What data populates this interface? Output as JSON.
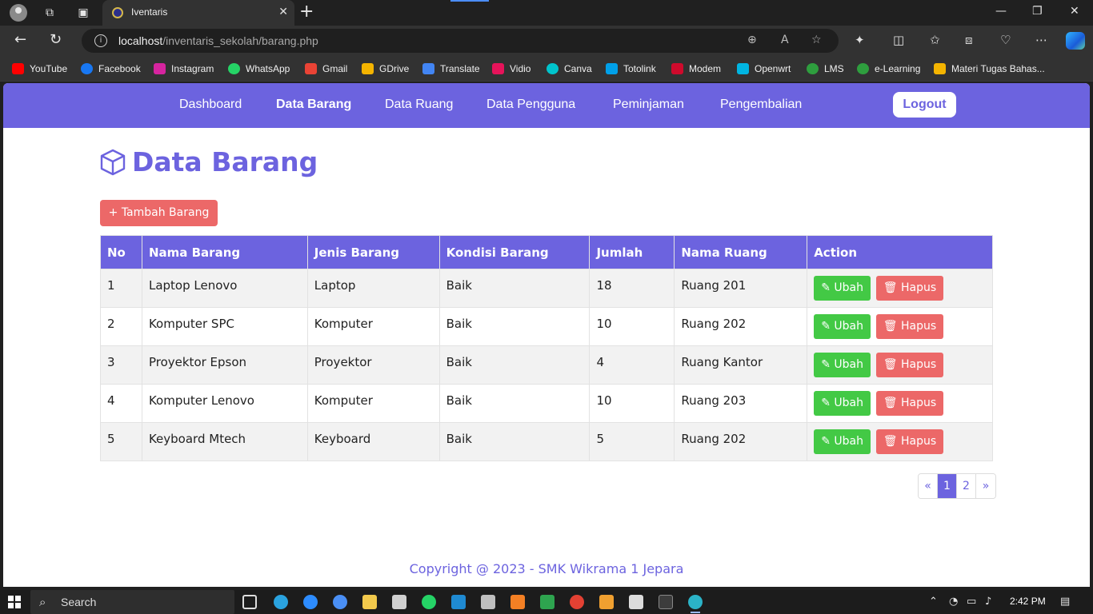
{
  "browser": {
    "tab_title": "Iventaris",
    "url_host": "localhost",
    "url_path": "/inventaris_sekolah/barang.php",
    "bookmarks": [
      {
        "label": "YouTube",
        "icon": "youtube-icon",
        "color": "#ff0000"
      },
      {
        "label": "Facebook",
        "icon": "facebook-icon",
        "color": "#1877f2"
      },
      {
        "label": "Instagram",
        "icon": "instagram-icon",
        "color": "#d6249f"
      },
      {
        "label": "WhatsApp",
        "icon": "whatsapp-icon",
        "color": "#25d366"
      },
      {
        "label": "Gmail",
        "icon": "gmail-icon",
        "color": "#ea4335"
      },
      {
        "label": "GDrive",
        "icon": "gdrive-icon",
        "color": "#f4b400"
      },
      {
        "label": "Translate",
        "icon": "translate-icon",
        "color": "#4285f4"
      },
      {
        "label": "Vidio",
        "icon": "vidio-icon",
        "color": "#e6135a"
      },
      {
        "label": "Canva",
        "icon": "canva-icon",
        "color": "#00c4cc"
      },
      {
        "label": "Totolink",
        "icon": "totolink-icon",
        "color": "#00a0e9"
      },
      {
        "label": "Modem",
        "icon": "modem-icon",
        "color": "#cf0a2c"
      },
      {
        "label": "Openwrt",
        "icon": "openwrt-icon",
        "color": "#00b5e2"
      },
      {
        "label": "LMS",
        "icon": "lms-icon",
        "color": "#2e9e3e"
      },
      {
        "label": "e-Learning",
        "icon": "elearning-icon",
        "color": "#2e9e3e"
      },
      {
        "label": "Materi Tugas Bahas...",
        "icon": "gdrive-icon",
        "color": "#f4b400"
      }
    ]
  },
  "nav": {
    "links": [
      "Dashboard",
      "Data Barang",
      "Data Ruang",
      "Data Pengguna",
      "Peminjaman",
      "Pengembalian"
    ],
    "active": "Data Barang",
    "logout_label": "Logout"
  },
  "colors": {
    "accent": "#6c63df",
    "success": "#43c945",
    "danger": "#ec6868"
  },
  "main": {
    "title": "Data Barang",
    "add_button_label": "+ Tambah Barang",
    "table": {
      "headers": [
        "No",
        "Nama Barang",
        "Jenis Barang",
        "Kondisi Barang",
        "Jumlah",
        "Nama Ruang",
        "Action"
      ],
      "rows": [
        [
          "1",
          "Laptop Lenovo",
          "Laptop",
          "Baik",
          "18",
          "Ruang 201"
        ],
        [
          "2",
          "Komputer SPC",
          "Komputer",
          "Baik",
          "10",
          "Ruang 202"
        ],
        [
          "3",
          "Proyektor Epson",
          "Proyektor",
          "Baik",
          "4",
          "Ruang Kantor"
        ],
        [
          "4",
          "Komputer Lenovo",
          "Komputer",
          "Baik",
          "10",
          "Ruang 203"
        ],
        [
          "5",
          "Keyboard Mtech",
          "Keyboard",
          "Baik",
          "5",
          "Ruang 202"
        ]
      ],
      "edit_label": "Ubah",
      "delete_label": "Hapus"
    },
    "pagination": {
      "prev": "«",
      "pages": [
        "1",
        "2"
      ],
      "current": "1",
      "next": "»"
    }
  },
  "footer": {
    "text": "Copyright @ 2023 - SMK Wikrama 1 Jepara"
  },
  "taskbar": {
    "search_label": "Search",
    "time": "2:42 PM"
  }
}
